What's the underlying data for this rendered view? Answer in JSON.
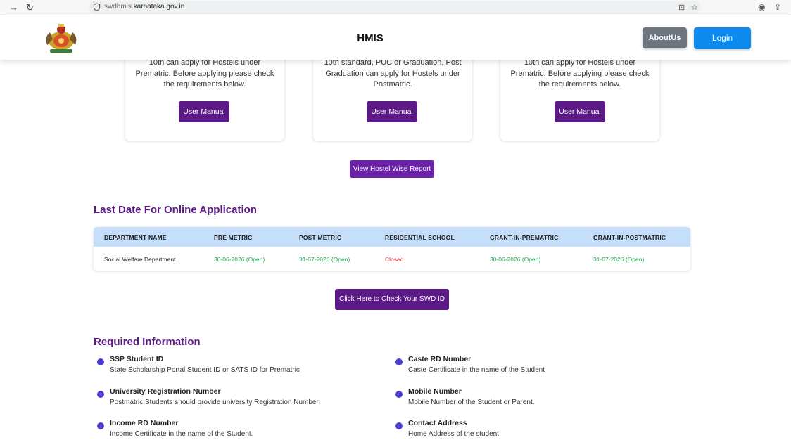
{
  "browser": {
    "url_prefix": "swdhmis.",
    "url_domain": "karnataka.gov.in",
    "back_icon": "back-arrow-icon",
    "forward_icon": "forward-arrow-icon",
    "reload_icon": "reload-icon"
  },
  "header": {
    "title": "HMIS",
    "about_label": "AboutUs",
    "login_label": "Login"
  },
  "cards": [
    {
      "text": "10th can apply for Hostels under Prematric. Before applying please check the requirements below.",
      "button": "User Manual"
    },
    {
      "text": "10th standard, PUC or Graduation, Post Graduation can apply for Hostels under Postmatric.",
      "button": "User Manual"
    },
    {
      "text": "10th can apply for Hostels under Prematric. Before applying please check the requirements below.",
      "button": "User Manual"
    }
  ],
  "report_button": "View Hostel Wise Report",
  "last_date": {
    "title": "Last Date For Online Application",
    "headers": [
      "DEPARTMENT NAME",
      "PRE METRIC",
      "POST METRIC",
      "RESIDENTIAL SCHOOL",
      "GRANT-IN-PREMATRIC",
      "GRANT-IN-POSTMATRIC"
    ],
    "row": [
      "Social Welfare Department",
      "30-06-2026 (Open)",
      "31-07-2026 (Open)",
      "Closed",
      "30-06-2026 (Open)",
      "31-07-2026 (Open)"
    ]
  },
  "swd_button": "Click Here to Check Your SWD ID",
  "required": {
    "title": "Required Information",
    "items": [
      {
        "title": "SSP Student ID",
        "desc": "State Scholarship Portal Student ID or SATS ID for Prematric"
      },
      {
        "title": "Caste RD Number",
        "desc": "Caste Certificate in the name of the Student"
      },
      {
        "title": "University Registration Number",
        "desc": "Postmatric Students should provide university Registration Number."
      },
      {
        "title": "Mobile Number",
        "desc": "Mobile Number of the Student or Parent."
      },
      {
        "title": "Income RD Number",
        "desc": "Income Certificate in the name of the Student."
      },
      {
        "title": "Contact Address",
        "desc": "Home Address of the student."
      }
    ]
  },
  "colors": {
    "primary_purple": "#5b1a86",
    "header_blue": "#c5dffb",
    "open_green": "#1fa64a",
    "closed_red": "#d12b2b",
    "login_blue": "#0d8af0"
  }
}
